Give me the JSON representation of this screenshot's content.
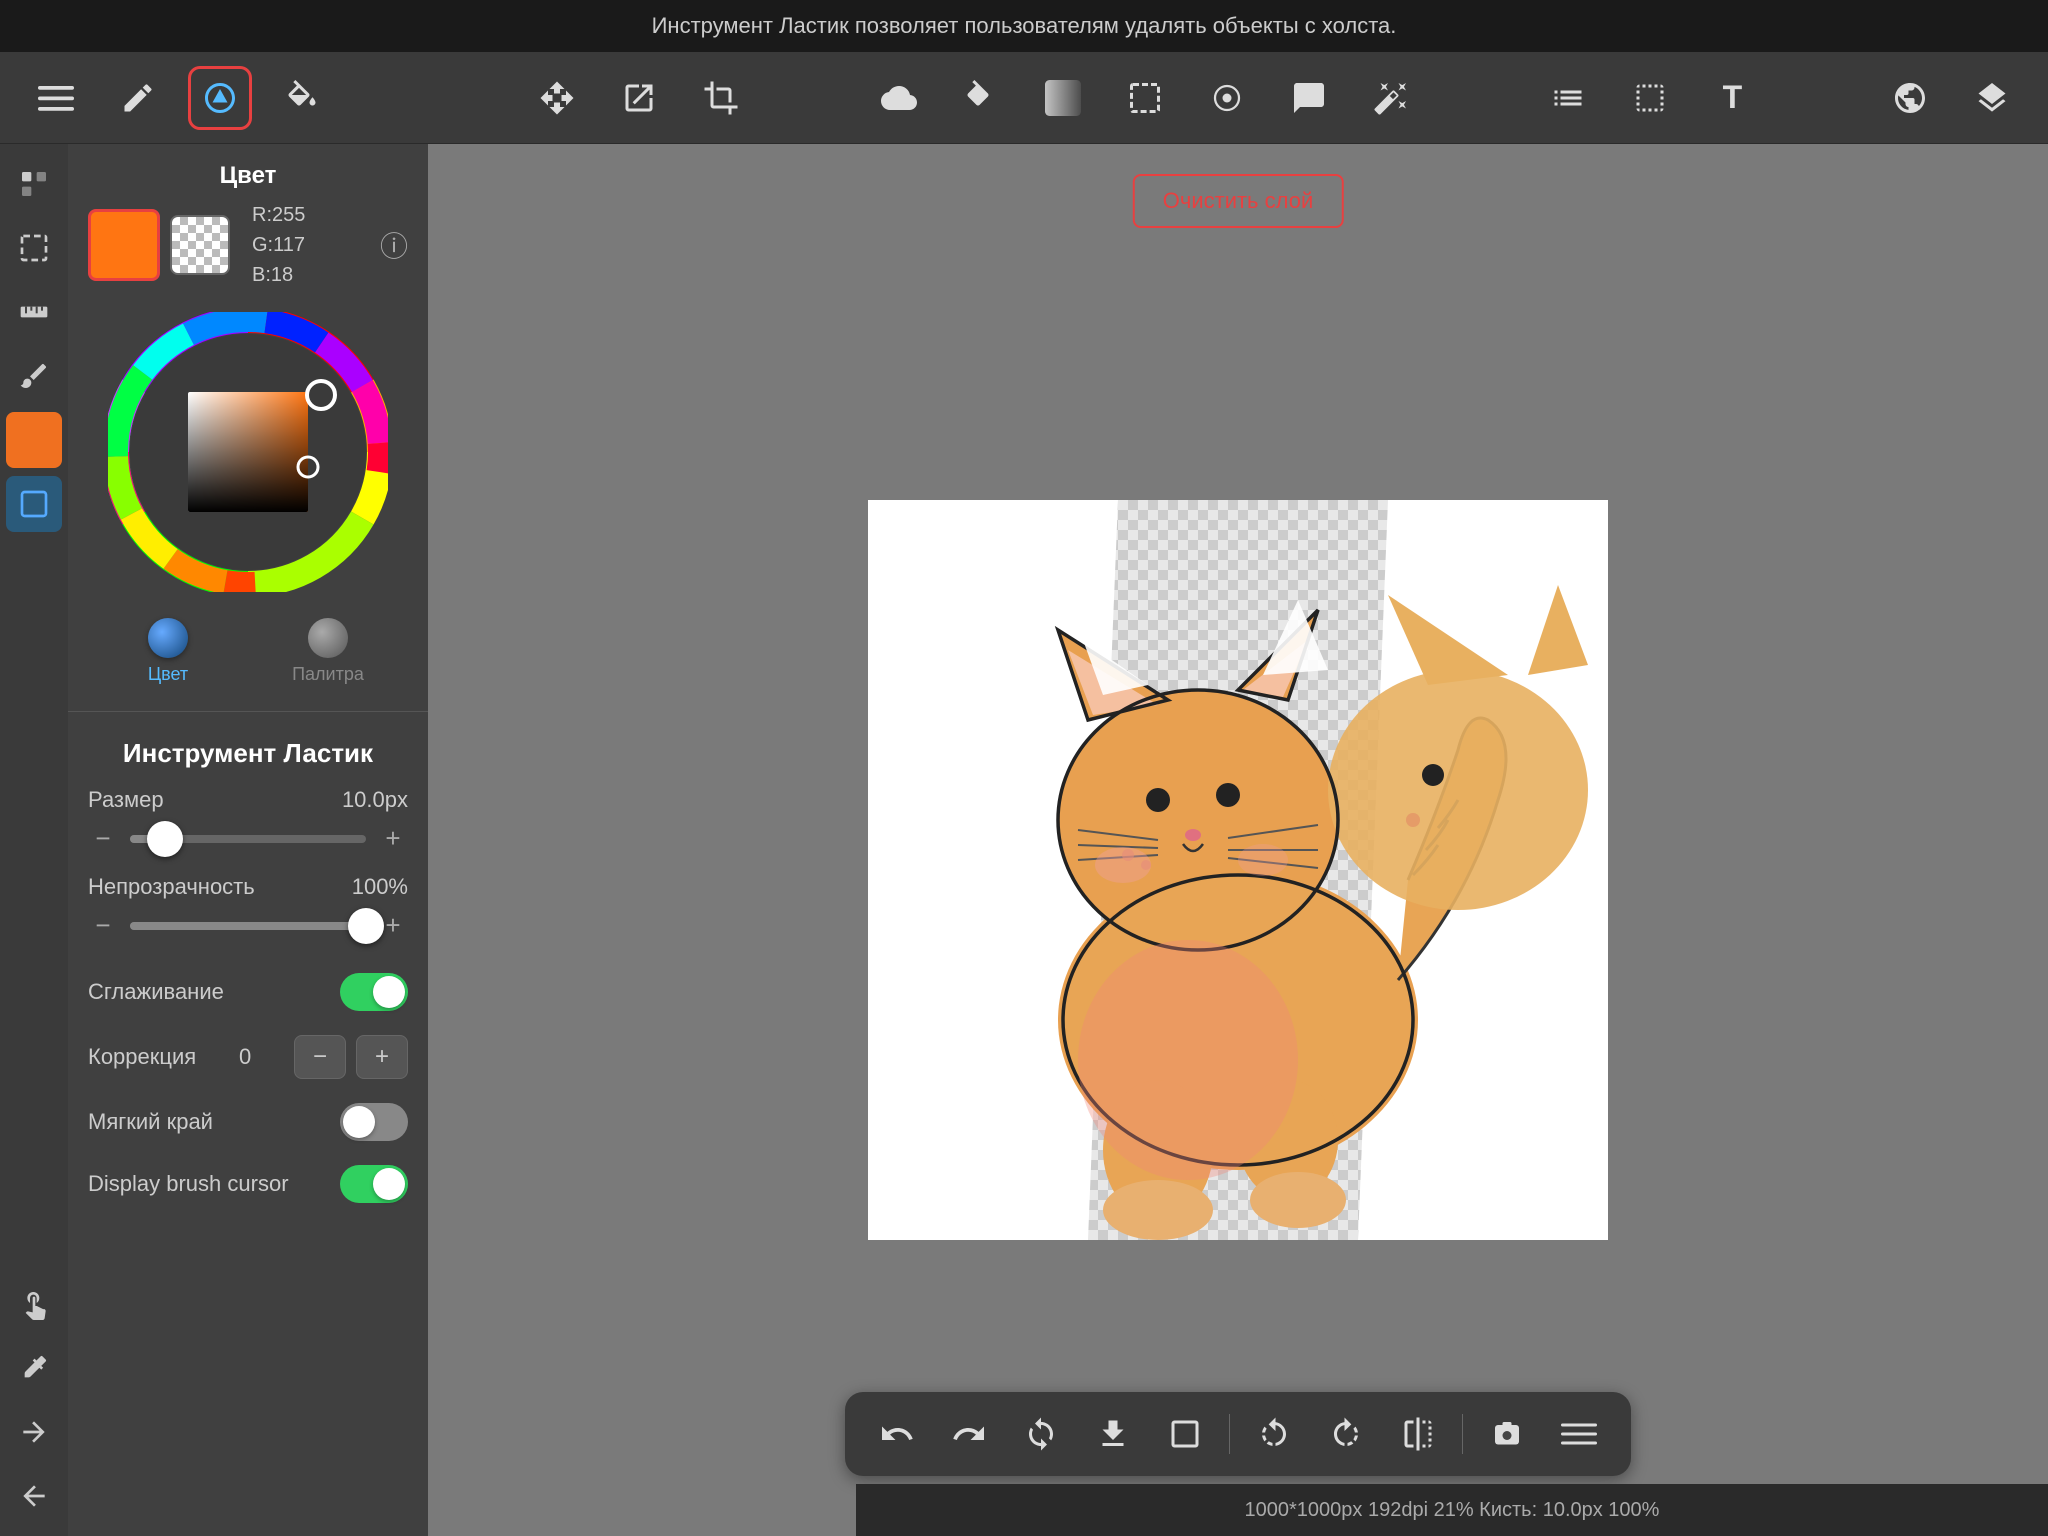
{
  "topBar": {
    "text": "Инструмент Ластик позволяет пользователям удалять объекты с холста."
  },
  "toolbar": {
    "tools": [
      {
        "id": "menu",
        "label": "☰",
        "active": false
      },
      {
        "id": "pencil",
        "label": "✏",
        "active": false
      },
      {
        "id": "eraser",
        "label": "◇",
        "active": true
      },
      {
        "id": "fill",
        "label": "✦",
        "active": false
      },
      {
        "id": "move",
        "label": "✛",
        "active": false
      },
      {
        "id": "transform",
        "label": "⬡",
        "active": false
      },
      {
        "id": "transform2",
        "label": "⬢",
        "active": false
      },
      {
        "id": "lasso",
        "label": "⬟",
        "active": false
      },
      {
        "id": "bucket",
        "label": "⌽",
        "active": false
      },
      {
        "id": "gradient",
        "label": "▣",
        "active": false
      },
      {
        "id": "rect-select",
        "label": "⬜",
        "active": false
      },
      {
        "id": "color-pick",
        "label": "⊕",
        "active": false
      },
      {
        "id": "smart",
        "label": "✐",
        "active": false
      },
      {
        "id": "magic",
        "label": "◆",
        "active": false
      },
      {
        "id": "layers2",
        "label": "⧉",
        "active": false
      },
      {
        "id": "select2",
        "label": "⌕",
        "active": false
      },
      {
        "id": "text",
        "label": "T",
        "active": false
      },
      {
        "id": "globe",
        "label": "🌐",
        "active": false
      },
      {
        "id": "layers",
        "label": "⊞",
        "active": false
      }
    ]
  },
  "colorPanel": {
    "title": "Цвет",
    "rgb": {
      "r": "R:255",
      "g": "G:117",
      "b": "B:18"
    },
    "colorTabActive": "Цвет",
    "colorTabPalette": "Палитра"
  },
  "toolPanel": {
    "title": "Инструмент Ластик",
    "size": {
      "label": "Размер",
      "value": "10.0px",
      "percent": 15
    },
    "opacity": {
      "label": "Непрозрачность",
      "value": "100%",
      "percent": 100
    },
    "smoothing": {
      "label": "Сглаживание",
      "on": true
    },
    "correction": {
      "label": "Коррекция",
      "value": "0"
    },
    "softEdge": {
      "label": "Мягкий край",
      "on": false
    },
    "displayBrushCursor": {
      "label": "Display brush cursor",
      "on": true
    }
  },
  "canvas": {
    "clearLayerBtn": "Очистить слой",
    "statusText": "1000*1000px 192dpi 21% Кисть: 10.0px 100%"
  },
  "bottomToolbar": {
    "buttons": [
      {
        "id": "undo",
        "label": "↩"
      },
      {
        "id": "redo",
        "label": "↪"
      },
      {
        "id": "rotate-ccw2",
        "label": "↺"
      },
      {
        "id": "download",
        "label": "⬇"
      },
      {
        "id": "crop",
        "label": "▭"
      },
      {
        "id": "rotate-ccw",
        "label": "↺"
      },
      {
        "id": "rotate-cw",
        "label": "↻"
      },
      {
        "id": "flip",
        "label": "↔"
      },
      {
        "id": "camera",
        "label": "▪"
      },
      {
        "id": "menu2",
        "label": "≡"
      }
    ]
  }
}
